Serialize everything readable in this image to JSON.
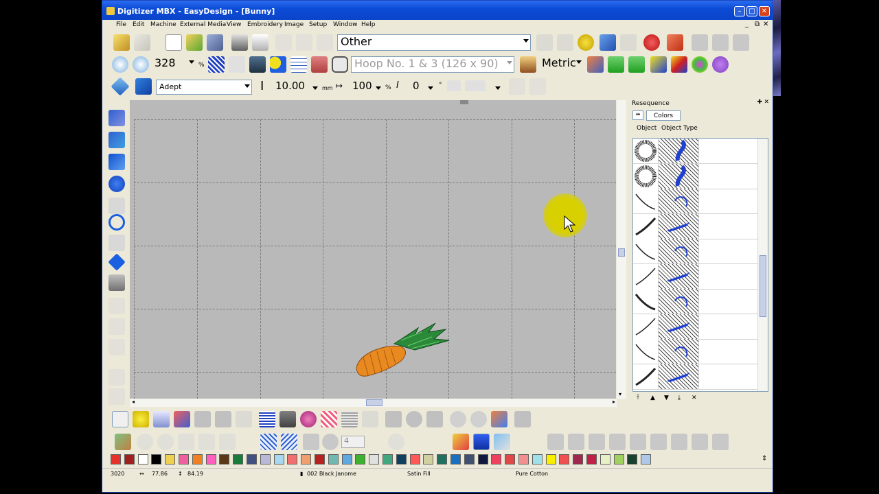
{
  "window": {
    "title": "Digitizer MBX - EasyDesign - [Bunny]",
    "caption_buttons": [
      "minimize",
      "maximize",
      "close"
    ],
    "mdi_buttons": [
      "_",
      "⧉",
      "✕"
    ]
  },
  "menu": [
    "File",
    "Edit",
    "Machine",
    "External Media",
    "View",
    "Embroidery",
    "Image",
    "Setup",
    "Window",
    "Help"
  ],
  "toolbar1": {
    "design_type": "Other"
  },
  "toolbar2": {
    "zoom_value": "328",
    "zoom_unit": "%",
    "hoop": "Hoop No. 1 & 3 (126 x 90)",
    "units": "Metric"
  },
  "toolbar3": {
    "font": "Adept",
    "height_value": "10.00",
    "height_unit": "mm",
    "width_value": "100",
    "width_unit": "%",
    "angle_value": "0",
    "angle_unit": "°"
  },
  "resequence": {
    "title": "Resequence",
    "tab_label": "Colors",
    "col_object": "Object",
    "col_object_type": "Object Type",
    "rows": 10
  },
  "stepper_value": "4",
  "palette": [
    "#e8302a",
    "#a02020",
    "#ffffff",
    "#000000",
    "#f0d050",
    "#f060a0",
    "#f08020",
    "#ff60c0",
    "#583818",
    "#1a7a3a",
    "#405080",
    "#b8b8d8",
    "#a8d8f0",
    "#f07070",
    "#f0a070",
    "#b82020",
    "#70b8b0",
    "#60a8e0",
    "#40b030",
    "#e0e0e0",
    "#40a880",
    "#104060",
    "#ff5858",
    "#d0d0a0",
    "#207060",
    "#1a70c0",
    "#405070",
    "#101840",
    "#f04060",
    "#e04848",
    "#f09090",
    "#a0e0e8",
    "#f8f000",
    "#f05050",
    "#a02850",
    "#c02048",
    "#e8f0c8",
    "#a0d060",
    "#1a4030",
    "#b0c8e8"
  ],
  "status": {
    "stitches": "3020",
    "width": "77.86",
    "height": "84.19",
    "thread": "002 Black Janome",
    "stitch_type": "Satin Fill",
    "fabric": "Pure Cotton"
  }
}
